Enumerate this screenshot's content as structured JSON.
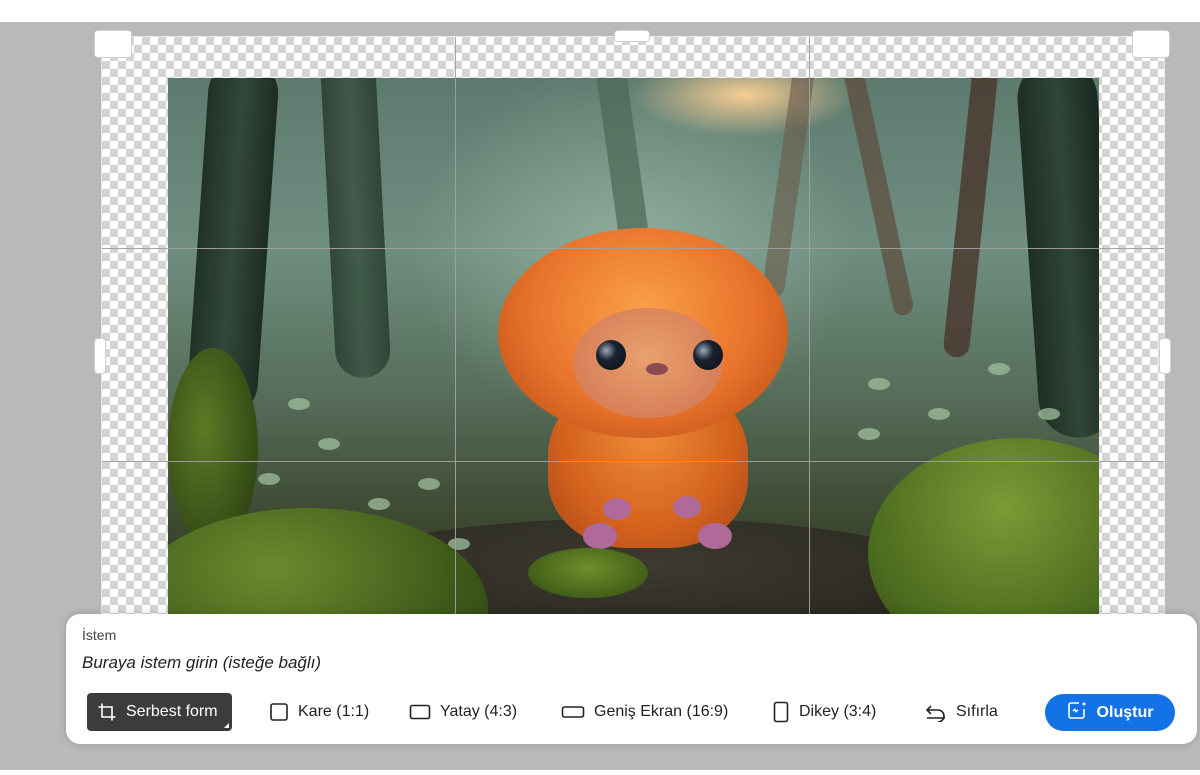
{
  "prompt_panel": {
    "label": "İstem",
    "placeholder": "Buraya istem girin (isteğe bağlı)"
  },
  "toolbar": {
    "freeform": {
      "label": "Serbest form",
      "icon": "crop-icon",
      "selected": true
    },
    "square": {
      "label": "Kare (1:1)",
      "icon": "square-icon"
    },
    "landscape": {
      "label": "Yatay (4:3)",
      "icon": "landscape-rect-icon"
    },
    "widescreen": {
      "label": "Geniş Ekran (16:9)",
      "icon": "widescreen-rect-icon"
    },
    "portrait": {
      "label": "Dikey (3:4)",
      "icon": "portrait-rect-icon"
    },
    "reset": {
      "label": "Sıfırla",
      "icon": "undo-icon"
    },
    "generate": {
      "label": "Oluştur",
      "icon": "generative-expand-icon"
    }
  },
  "colors": {
    "accent": "#1373e6",
    "active_tool_bg": "#3c3c3c",
    "canvas_bg": "#b9b9b9"
  }
}
